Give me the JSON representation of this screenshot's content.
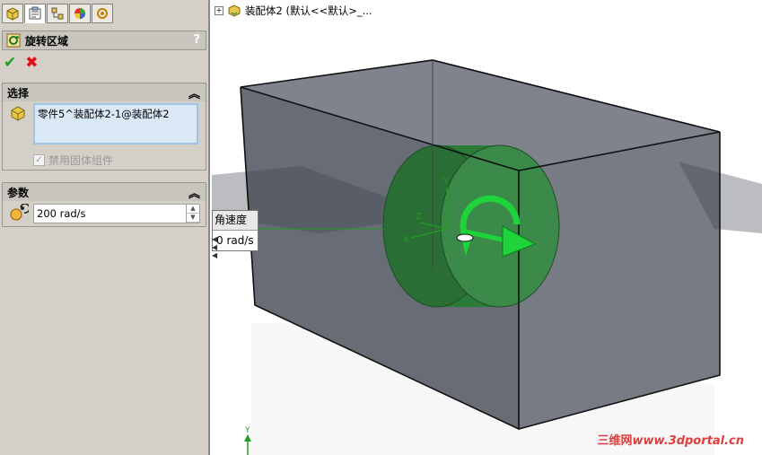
{
  "tabs": [
    {
      "name": "feature-manager",
      "icon": "feature-tree-icon"
    },
    {
      "name": "property-manager",
      "icon": "property-sheet-icon"
    },
    {
      "name": "configuration-manager",
      "icon": "configuration-icon"
    },
    {
      "name": "display-manager",
      "icon": "appearance-icon"
    },
    {
      "name": "custom-manager",
      "icon": "dimxpert-icon"
    }
  ],
  "property_manager": {
    "title": "旋转区域",
    "help": "?",
    "ok_icon": "check-icon",
    "cancel_icon": "close-icon"
  },
  "selection": {
    "header": "选择",
    "selected_item": "零件5^装配体2-1@装配体2",
    "disable_solid_label": "禁用固体组件",
    "disable_solid_checked": true
  },
  "parameters": {
    "header": "参数",
    "angular_velocity": "200 rad/s"
  },
  "viewport": {
    "tree_root": "装配体2  (默认<<默认>_...",
    "callout_title": "角速度",
    "callout_value": "0 rad/s"
  },
  "watermark": {
    "cn": "三维网",
    "url": "www.3dportal.cn"
  },
  "colors": {
    "panel_bg": "#d4d0c8",
    "accent_green": "#1f9e1f",
    "cylinder": "#2e7d3a",
    "box_fill": "#606672"
  }
}
